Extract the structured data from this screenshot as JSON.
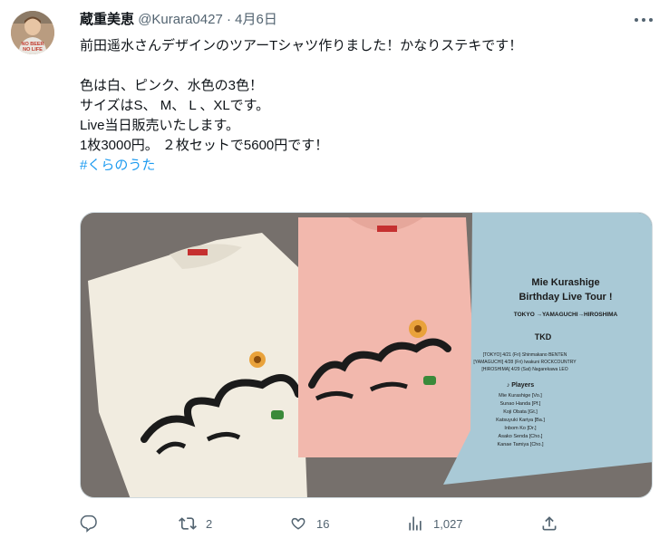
{
  "tweet": {
    "author_name": "蔵重美恵",
    "handle": "@Kurara0427",
    "separator": "·",
    "date": "4月6日",
    "lines": [
      "前田遥水さんデザインのツアーTシャツ作りました！かなりステキです！",
      "",
      "色は白、ピンク、水色の3色！",
      "サイズはS、 M、 L 、XLです。",
      "Live当日販売いたします。",
      "1枚3000円。 ２枚セットで5600円です！"
    ],
    "hashtag": "#くらのうた"
  },
  "avatar_shirt_text": [
    "NO BEER",
    "NO LIFE"
  ],
  "photo": {
    "shirt_print_title": [
      "Mie Kurashige",
      "Birthday Live Tour !"
    ],
    "tour_route": "TOKYO →YAMAGUCHI→HIROSHIMA",
    "tour_dates": [
      "[TOKYO] 4/21 (Fri) Shinmakano BENTEN",
      "[YAMAGUCHI] 4/28 (Fri) Iwakuni ROCKCOUNTRY",
      "[HIROSHIMA] 4/29 (Sat) Nagarekawa LEO"
    ],
    "players_heading": "♪ Players",
    "players": [
      "Mie Kurashige [Vo.]",
      "Sunao Handa [Pf.]",
      "Koji Obata [Gt.]",
      "Katsuyuki Kariya [Ba.]",
      "Inbom Ko [Dr.]",
      "Asako Senda [Cho.]",
      "Kanae Tamiya [Cho.]"
    ]
  },
  "actions": {
    "reply_icon": "reply-icon",
    "retweet_icon": "retweet-icon",
    "retweet_count": "2",
    "like_icon": "heart-icon",
    "like_count": "16",
    "views_icon": "views-icon",
    "views_count": "1,027",
    "share_icon": "share-icon"
  },
  "colors": {
    "text": "#0f1419",
    "secondary": "#536471",
    "link": "#1d9bf0",
    "shirt_white": "#f1ece0",
    "shirt_pink": "#f2b8ad",
    "shirt_blue": "#a9c9d6"
  }
}
